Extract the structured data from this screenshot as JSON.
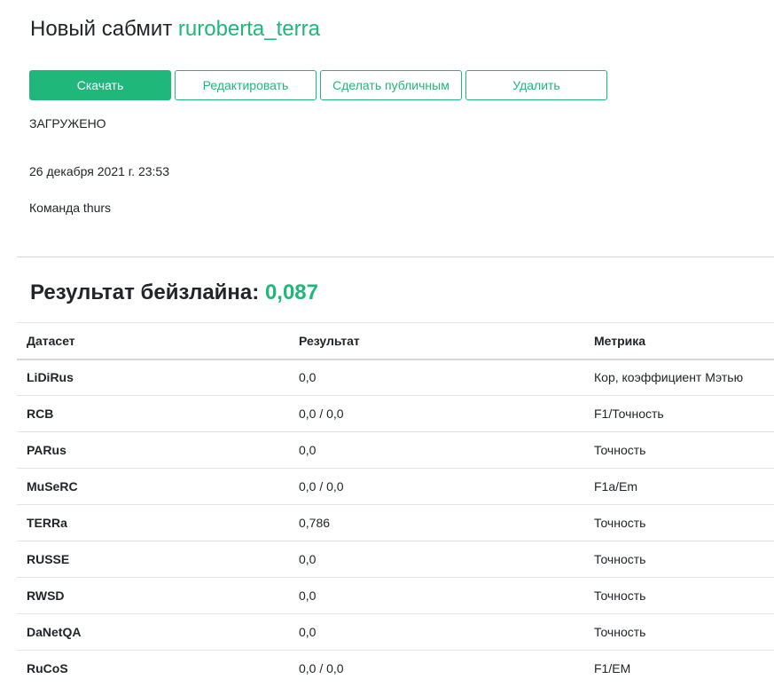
{
  "header": {
    "title_prefix": "Новый сабмит",
    "submission_name": "ruroberta_terra"
  },
  "actions": {
    "download": "Скачать",
    "edit": "Редактировать",
    "make_public": "Сделать публичным",
    "delete": "Удалить"
  },
  "info": {
    "status": "ЗАГРУЖЕНО",
    "date": "26 декабря 2021 г. 23:53",
    "team": "Команда thurs"
  },
  "baseline": {
    "label": "Результат бейзлайна:",
    "value": "0,087"
  },
  "table": {
    "headers": [
      "Датасет",
      "Результат",
      "Метрика"
    ],
    "rows": [
      {
        "dataset": "LiDiRus",
        "result": "0,0",
        "metric": "Кор, коэффициент Мэтью"
      },
      {
        "dataset": "RCB",
        "result": "0,0 / 0,0",
        "metric": "F1/Точность"
      },
      {
        "dataset": "PARus",
        "result": "0,0",
        "metric": "Точность"
      },
      {
        "dataset": "MuSeRC",
        "result": "0,0 / 0,0",
        "metric": "F1a/Em"
      },
      {
        "dataset": "TERRa",
        "result": "0,786",
        "metric": "Точность"
      },
      {
        "dataset": "RUSSE",
        "result": "0,0",
        "metric": "Точность"
      },
      {
        "dataset": "RWSD",
        "result": "0,0",
        "metric": "Точность"
      },
      {
        "dataset": "DaNetQA",
        "result": "0,0",
        "metric": "Точность"
      },
      {
        "dataset": "RuCoS",
        "result": "0,0 / 0,0",
        "metric": "F1/EM"
      }
    ]
  },
  "colors": {
    "accent": "#20b77a",
    "text": "#212529",
    "divider": "#d6d6d6"
  }
}
